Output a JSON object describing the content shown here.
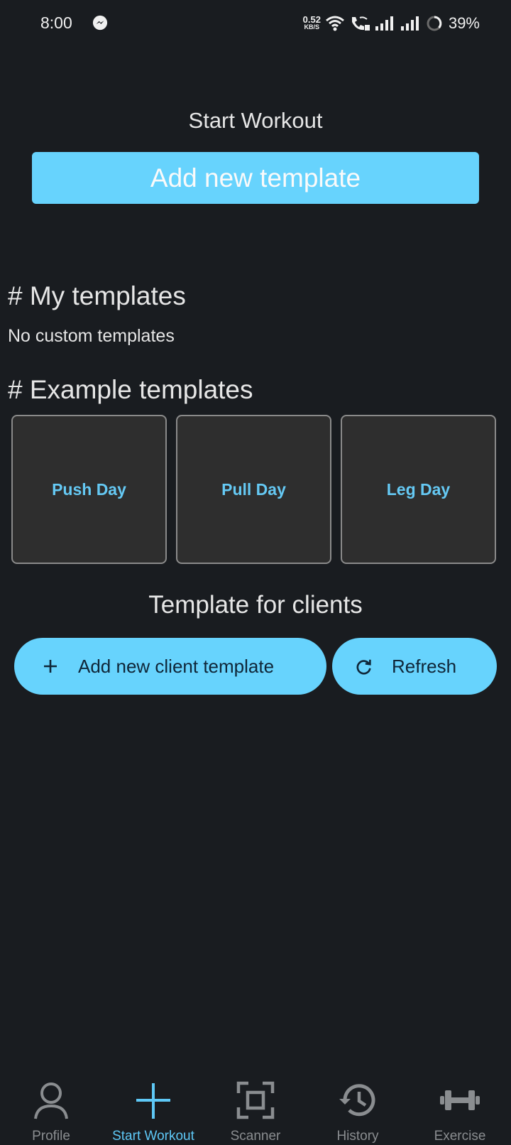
{
  "status_bar": {
    "time": "8:00",
    "net_speed_value": "0.52",
    "net_speed_unit": "KB/S",
    "battery_percent": "39%",
    "icons": [
      "messenger-icon",
      "wifi-icon",
      "wifi-call-icon",
      "signal-icon",
      "signal-icon",
      "battery-icon"
    ]
  },
  "header": {
    "title": "Start Workout",
    "add_template_label": "Add new template"
  },
  "my_templates": {
    "heading": "# My templates",
    "empty_text": "No custom templates"
  },
  "example_templates": {
    "heading": "# Example templates",
    "items": [
      {
        "label": "Push Day"
      },
      {
        "label": "Pull Day"
      },
      {
        "label": "Leg Day"
      }
    ]
  },
  "client_templates": {
    "heading": "Template for clients",
    "add_label": "Add new client template",
    "refresh_label": "Refresh"
  },
  "bottom_nav": {
    "items": [
      {
        "label": "Profile",
        "icon": "profile-icon"
      },
      {
        "label": "Start Workout",
        "icon": "plus-icon",
        "active": true
      },
      {
        "label": "Scanner",
        "icon": "scanner-icon"
      },
      {
        "label": "History",
        "icon": "history-icon"
      },
      {
        "label": "Exercise",
        "icon": "dumbbell-icon"
      }
    ]
  },
  "colors": {
    "background": "#191c20",
    "accent": "#67d3fd",
    "card": "#2e2e2e",
    "card_text": "#65c9f4",
    "nav_inactive": "#8a8d90"
  }
}
